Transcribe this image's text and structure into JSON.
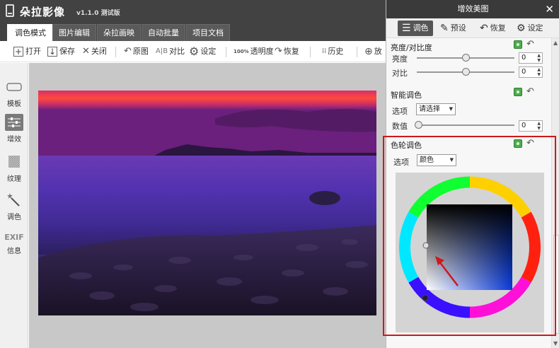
{
  "app": {
    "title": "朵拉影像",
    "version": "v1.1.0 测试版"
  },
  "tabs": [
    {
      "label": "调色模式",
      "active": true
    },
    {
      "label": "图片编辑",
      "active": false
    },
    {
      "label": "朵拉画映",
      "active": false
    },
    {
      "label": "自动批量",
      "active": false
    },
    {
      "label": "项目文档",
      "active": false
    }
  ],
  "toolbar": {
    "open": "打开",
    "save": "保存",
    "close": "关闭",
    "original": "原图",
    "compare_icon_text": "A|B",
    "compare": "对比",
    "settings": "设定",
    "opacity_icon_text": "100%",
    "opacity": "透明度",
    "restore": "恢复",
    "history": "历史",
    "zoom": "放"
  },
  "sidebar": [
    {
      "label": "模板",
      "icon": "template-icon",
      "active": false
    },
    {
      "label": "增效",
      "icon": "enhance-icon",
      "active": true
    },
    {
      "label": "纹理",
      "icon": "texture-icon",
      "active": false
    },
    {
      "label": "调色",
      "icon": "magic-wand-icon",
      "active": false
    },
    {
      "label": "信息",
      "icon_text": "EXIF",
      "active": false
    }
  ],
  "panel": {
    "title": "增效美图",
    "close": "✕",
    "tabs": [
      {
        "label": "调色",
        "icon": "sliders-icon",
        "active": true
      },
      {
        "label": "预设",
        "icon": "brush-icon",
        "active": false
      },
      {
        "label": "恢复",
        "icon": "undo-icon",
        "active": false
      },
      {
        "label": "设定",
        "icon": "gear-icon",
        "active": false
      }
    ],
    "brightness_contrast": {
      "title": "亮度/对比度",
      "brightness_label": "亮度",
      "brightness_value": "0",
      "contrast_label": "对比",
      "contrast_value": "0"
    },
    "smart_color": {
      "title": "智能调色",
      "option_label": "选项",
      "option_value": "请选择",
      "value_label": "数值",
      "value": "0"
    },
    "color_wheel": {
      "title": "色轮调色",
      "option_label": "选项",
      "option_value": "颜色"
    }
  }
}
